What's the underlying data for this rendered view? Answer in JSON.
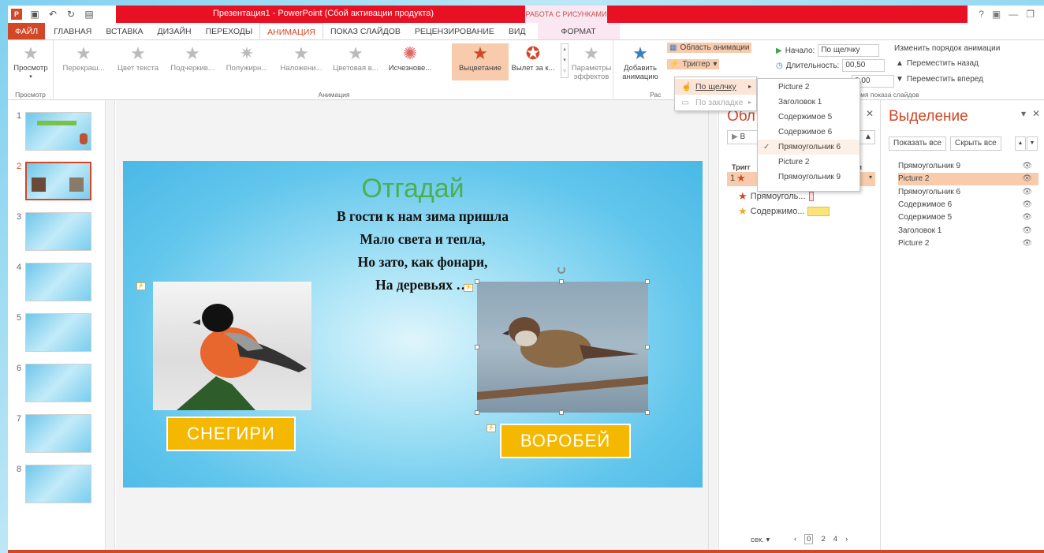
{
  "window_title": "Презентация1 - PowerPoint (Сбой активации продукта)",
  "context_header": "РАБОТА С РИСУНКАМИ",
  "window_controls": {
    "help": "?",
    "ribbon_opts": "▣",
    "min": "—",
    "max": "❐"
  },
  "tabs": [
    "ФАЙЛ",
    "ГЛАВНАЯ",
    "ВСТАВКА",
    "ДИЗАЙН",
    "ПЕРЕХОДЫ",
    "АНИМАЦИЯ",
    "ПОКАЗ СЛАЙДОВ",
    "РЕЦЕНЗИРОВАНИЕ",
    "ВИД"
  ],
  "context_tab": "ФОРМАТ",
  "active_tab": "АНИМАЦИЯ",
  "ribbon": {
    "preview_label": "Просмотр",
    "preview_group": "Просмотр",
    "animation_group": "Анимация",
    "effects": [
      "Перекраш...",
      "Цвет текста",
      "Подчеркив...",
      "Полужирн...",
      "Наложени...",
      "Цветовая в...",
      "Исчезнове...",
      "Выцветание",
      "Вылет за к..."
    ],
    "selected_effect": "Выцветание",
    "effect_params": "Параметры эффектов",
    "add_animation": "Добавить анимацию",
    "anim_pane_btn": "Область анимации",
    "trigger_btn": "Триггер",
    "adv_group_partial": "Рас",
    "start_label": "Начало:",
    "start_value": "По щелчку",
    "duration_label": "Длительность:",
    "duration_value": "00,50",
    "delay_value": "0,00",
    "reorder_title": "Изменить порядок анимации",
    "move_back": "Переместить назад",
    "move_forward": "Переместить вперед",
    "timing_group": "Время показа слайдов"
  },
  "trigger_menu": {
    "on_click": "По щелчку",
    "on_bookmark": "По закладке"
  },
  "trigger_targets": [
    "Picture 2",
    "Заголовок 1",
    "Содержимое 5",
    "Содержимое 6",
    "Прямоугольник 6",
    "Picture 2",
    "Прямоугольник 9"
  ],
  "trigger_checked": "Прямоугольник 6",
  "slides": [
    "1",
    "2",
    "3",
    "4",
    "5",
    "6",
    "7",
    "8"
  ],
  "selected_slide": "2",
  "slide": {
    "title": "Отгадай",
    "poem": [
      "В гости к нам зима пришла",
      "Мало света и тепла,",
      "Но зато, как фонари,",
      "На деревьях …"
    ],
    "label_left": "СНЕГИРИ",
    "label_right": "ВОРОБЕЙ"
  },
  "anim_pane": {
    "title": "Обл",
    "play_partial": "В",
    "trigger_partial": "Тригг",
    "col_partial": "ри",
    "row_num": "1",
    "item1": "Прямоуголь...",
    "item2": "Содержимо...",
    "seconds": "сек.",
    "timeline": [
      "0",
      "2",
      "4"
    ]
  },
  "sel_pane": {
    "title": "Выделение",
    "show_all": "Показать все",
    "hide_all": "Скрыть все",
    "items": [
      "Прямоугольник 9",
      "Picture 2",
      "Прямоугольник 6",
      "Содержимое 6",
      "Содержимое 5",
      "Заголовок 1",
      "Picture 2"
    ],
    "selected_index": 1
  },
  "colors": {
    "accent": "#d24726",
    "title_red": "#e81123",
    "selection": "#f8cbad",
    "label_bg": "#f5b800",
    "slide_title": "#4caf50"
  }
}
